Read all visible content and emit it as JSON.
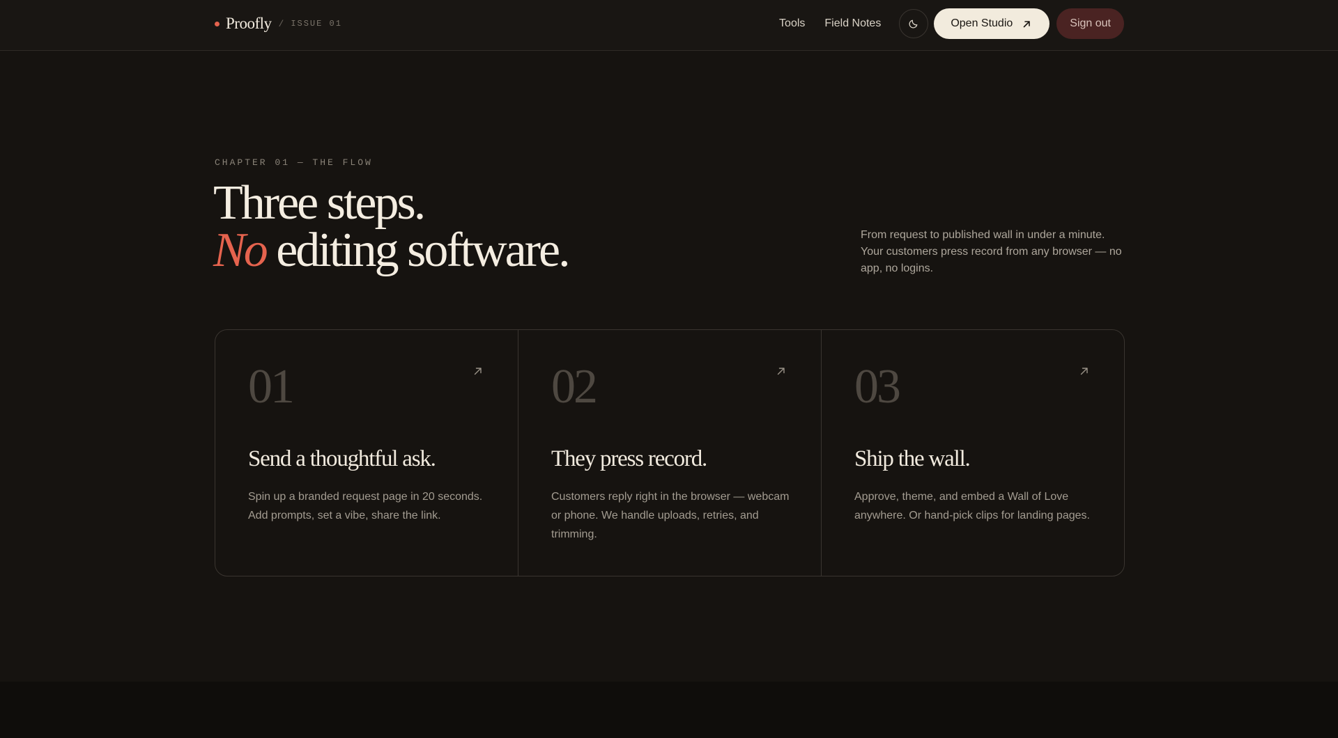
{
  "header": {
    "brand_name": "Proofly",
    "brand_separator": "/",
    "issue_label": "ISSUE 01",
    "nav_tools": "Tools",
    "nav_field_notes": "Field Notes",
    "theme_toggle_icon": "moon-icon",
    "open_studio_label": "Open Studio",
    "sign_out_label": "Sign out"
  },
  "hero": {
    "kicker": "CHAPTER 01 — THE FLOW",
    "headline_line1": "Three steps.",
    "headline_accent": "No",
    "headline_line2_rest": " editing software.",
    "lede": "From request to published wall in under a minute. Your customers press record from any browser — no app, no logins."
  },
  "steps": [
    {
      "number": "01",
      "title": "Send a thoughtful ask.",
      "body": "Spin up a branded request page in 20 seconds. Add prompts, set a vibe, share the link."
    },
    {
      "number": "02",
      "title": "They press record.",
      "body": "Customers reply right in the browser — webcam or phone. We handle uploads, retries, and trimming."
    },
    {
      "number": "03",
      "title": "Ship the wall.",
      "body": "Approve, theme, and embed a Wall of Love anywhere. Or hand-pick clips for landing pages."
    }
  ],
  "colors": {
    "background": "#161310",
    "accent": "#e5634e",
    "primary_button": "#f2ebdd",
    "sign_out_button": "#4a2322"
  }
}
